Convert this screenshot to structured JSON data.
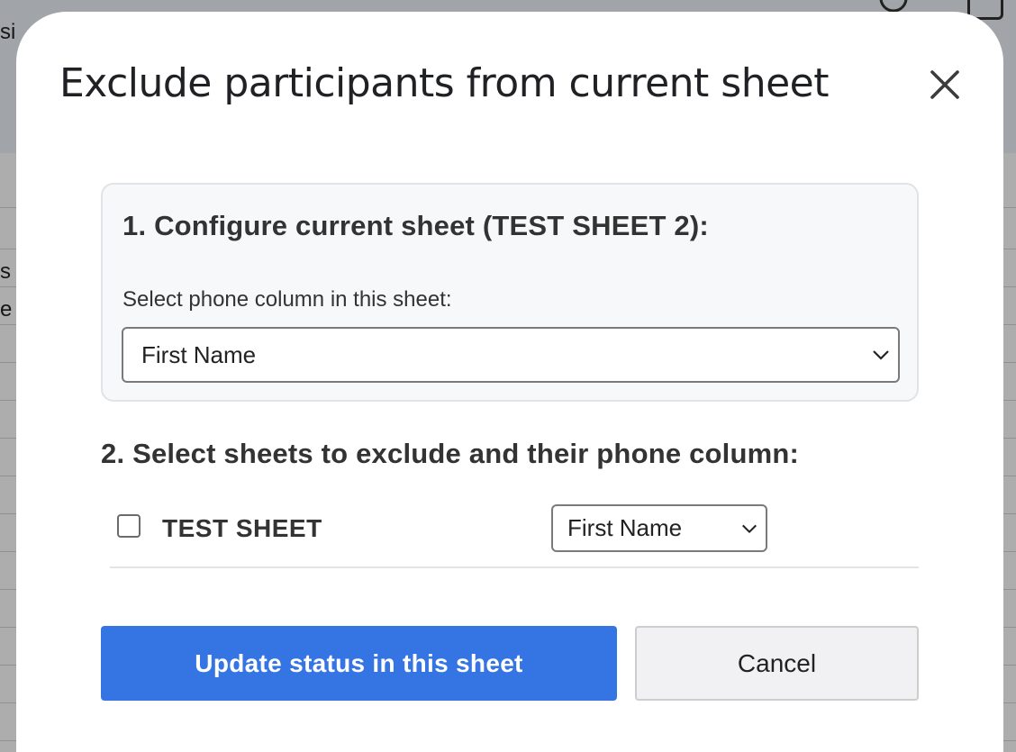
{
  "background": {
    "fragments": [
      "si",
      "s",
      "e"
    ]
  },
  "dialog": {
    "title": "Exclude participants from current sheet",
    "close_icon": "close-icon"
  },
  "current_sheet": {
    "heading": "1. Configure current sheet (TEST SHEET 2):",
    "phone_column_label": "Select phone column in this sheet:",
    "phone_column_value": "First Name"
  },
  "exclude_sheets": {
    "heading": "2. Select sheets to exclude and their phone column:",
    "rows": [
      {
        "name": "TEST SHEET",
        "checked": false,
        "phone_column_value": "First Name"
      }
    ]
  },
  "actions": {
    "primary_label": "Update status in this sheet",
    "secondary_label": "Cancel"
  },
  "colors": {
    "primary": "#3574e3",
    "text": "#333333"
  }
}
